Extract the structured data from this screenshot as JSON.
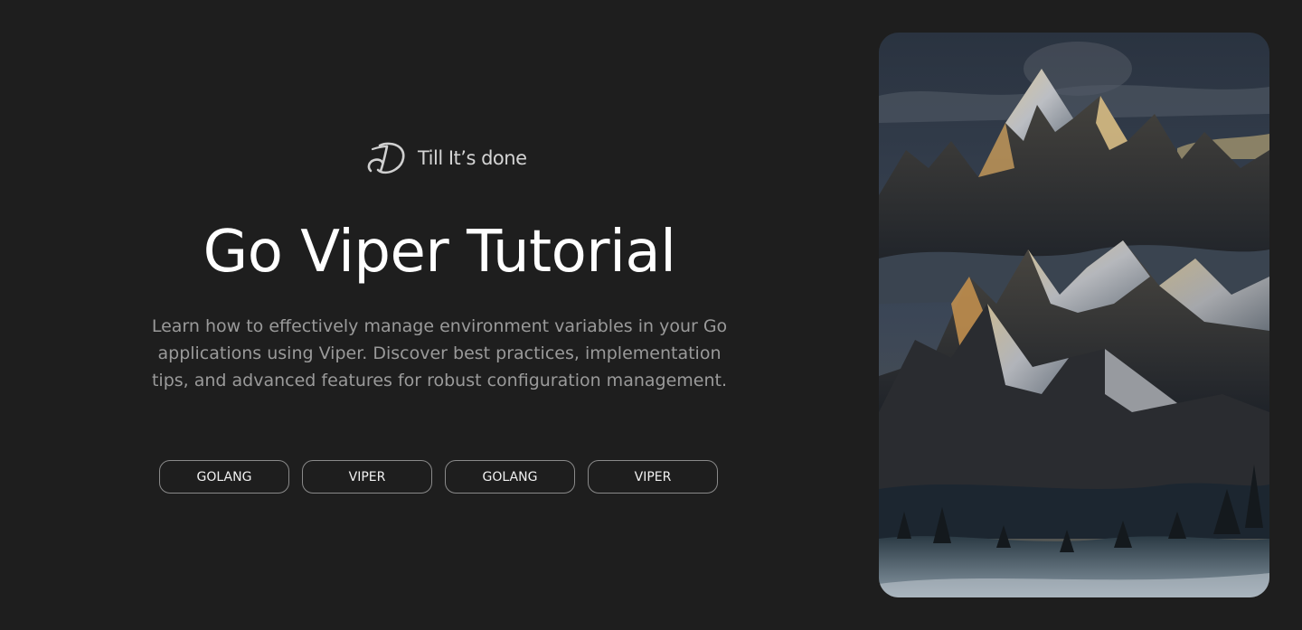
{
  "brand": {
    "name": "Till It’s done",
    "logo_icon": "signature-d-logo"
  },
  "hero": {
    "title": "Go Viper Tutorial",
    "description": "Learn how to effectively manage environment variables in your Go applications using Viper. Discover best practices, implementation tips, and advanced features for robust configuration management."
  },
  "tags": [
    {
      "label": "GOLANG"
    },
    {
      "label": "VIPER"
    },
    {
      "label": "GOLANG"
    },
    {
      "label": "VIPER"
    }
  ],
  "cover_image": {
    "subject": "mountain-landscape-illustration"
  },
  "colors": {
    "background": "#1e1e1e",
    "title": "#ffffff",
    "text_muted": "#9a9a9a",
    "tag_border": "#8a8a8a"
  }
}
